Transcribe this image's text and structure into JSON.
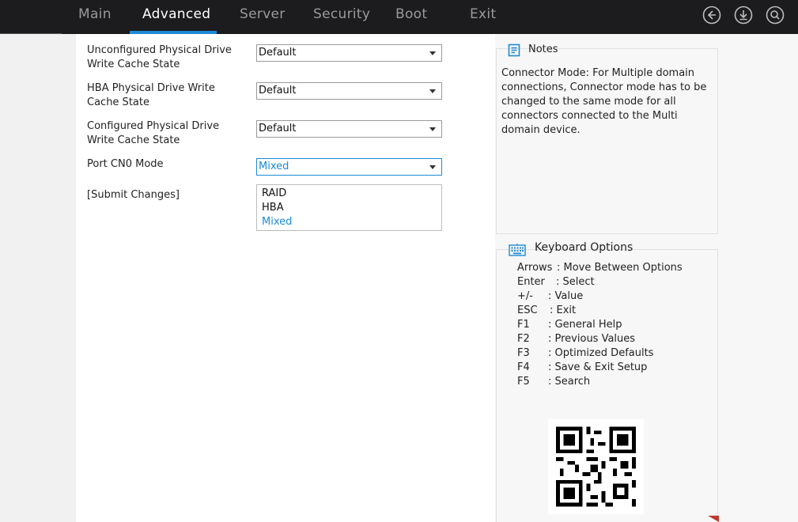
{
  "tabs": [
    {
      "label": "Main"
    },
    {
      "label": "Advanced"
    },
    {
      "label": "Server"
    },
    {
      "label": "Security"
    },
    {
      "label": "Boot"
    },
    {
      "label": "Exit"
    }
  ],
  "active_tab": "Advanced",
  "settings": [
    {
      "label": "Unconfigured Physical Drive Write Cache State",
      "value": "Default"
    },
    {
      "label": "HBA Physical Drive Write Cache State",
      "value": "Default"
    },
    {
      "label": "Configured Physical Drive Write Cache State",
      "value": "Default"
    },
    {
      "label": "Port CN0 Mode",
      "value": "Mixed"
    }
  ],
  "submit_label": "[Submit Changes]",
  "dropdown_options": [
    "RAID",
    "HBA",
    "Mixed"
  ],
  "dropdown_selected": "Mixed",
  "notes": {
    "title": "Notes",
    "text": "Connector Mode: For Multiple domain connections, Connector mode has to be changed to the same mode for all connectors connected to the Multi domain device."
  },
  "keyboard": {
    "title": "Keyboard Options",
    "rows": [
      {
        "key": "Arrows",
        "desc": ": Move Between Options"
      },
      {
        "key": "Enter",
        "desc": ": Select"
      },
      {
        "key": "+/-",
        "desc": ": Value"
      },
      {
        "key": "ESC",
        "desc": ": Exit"
      },
      {
        "key": "F1",
        "desc": ": General Help"
      },
      {
        "key": "F2",
        "desc": ": Previous Values"
      },
      {
        "key": "F3",
        "desc": ": Optimized Defaults"
      },
      {
        "key": "F4",
        "desc": ": Save & Exit Setup"
      },
      {
        "key": "F5",
        "desc": ": Search"
      }
    ]
  },
  "icons": [
    "back-icon",
    "download-icon",
    "search-icon"
  ],
  "colors": {
    "accent": "#1d8ad6",
    "topbar": "#1c1c1f"
  }
}
